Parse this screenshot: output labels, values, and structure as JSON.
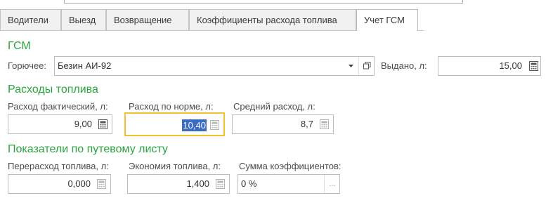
{
  "tabs": [
    {
      "label": "Водители",
      "active": false
    },
    {
      "label": "Выезд",
      "active": false
    },
    {
      "label": "Возвращение",
      "active": false
    },
    {
      "label": "Коэффициенты расхода топлива",
      "active": false
    },
    {
      "label": "Учет ГСМ",
      "active": true
    }
  ],
  "gsm": {
    "title": "ГСМ",
    "fuel_label": "Горючее:",
    "fuel_value": "Безин АИ-92",
    "issued_label": "Выдано, л:",
    "issued_value": "15,00"
  },
  "consumption": {
    "title": "Расходы топлива",
    "actual_label": "Расход фактический, л:",
    "actual_value": "9,00",
    "norm_label": "Расход по норме, л:",
    "norm_value": "10,40",
    "avg_label": "Средний расход, л:",
    "avg_value": "8,7"
  },
  "waybill": {
    "title": "Показатели по путевому листу",
    "overrun_label": "Перерасход топлива, л:",
    "overrun_value": "0,000",
    "saving_label": "Экономия топлива, л:",
    "saving_value": "1,400",
    "coef_label": "Сумма коэффициентов:",
    "coef_value": "0 %",
    "coef_button": "..."
  },
  "colors": {
    "section": "#2aa541",
    "focus": "#f2c231",
    "selection": "#3a6cc4"
  }
}
